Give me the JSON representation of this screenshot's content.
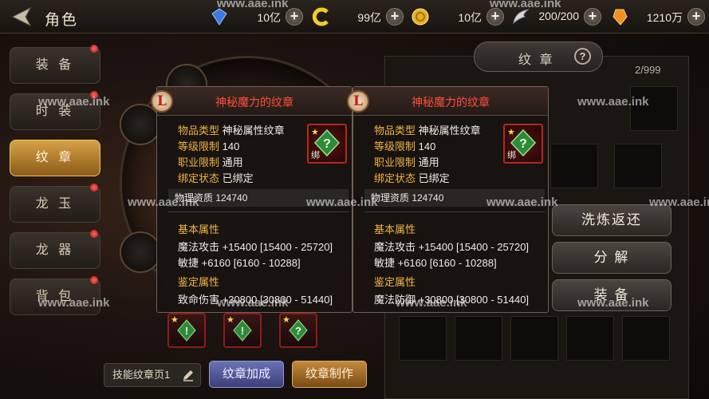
{
  "header": {
    "title": "角色",
    "resources": [
      {
        "icon": "blue-gem-icon",
        "value": "10亿"
      },
      {
        "icon": "yellow-swirl-icon",
        "value": "99亿"
      },
      {
        "icon": "gold-coin-icon",
        "value": "10亿"
      },
      {
        "icon": "silver-wing-icon",
        "value": "200/200"
      },
      {
        "icon": "amber-crystal-icon",
        "value": "1210万"
      }
    ]
  },
  "menu": [
    {
      "label": "装 备",
      "active": false,
      "dot": true
    },
    {
      "label": "时 装",
      "active": false,
      "dot": true
    },
    {
      "label": "纹 章",
      "active": true,
      "dot": false
    },
    {
      "label": "龙 玉",
      "active": false,
      "dot": true
    },
    {
      "label": "龙 器",
      "active": false,
      "dot": true
    },
    {
      "label": "背 包",
      "active": false,
      "dot": true
    }
  ],
  "bottom": {
    "page_select": "技能纹章页1",
    "enhance_button": "纹章加成",
    "craft_button": "纹章制作"
  },
  "right": {
    "title": "纹 章",
    "help": "?",
    "count": "2/999",
    "actions": [
      "洗炼返还",
      "分 解",
      "装 备"
    ]
  },
  "tooltips": [
    {
      "badge": "L",
      "name": "神秘魔力的纹章",
      "fields": [
        {
          "k": "物品类型",
          "v": "神秘属性纹章"
        },
        {
          "k": "等级限制",
          "v": "140"
        },
        {
          "k": "职业限制",
          "v": "通用"
        },
        {
          "k": "绑定状态",
          "v": "已绑定"
        }
      ],
      "icon_label": "绑",
      "aptitude": "物理资质   124740",
      "basic_title": "基本属性",
      "basic": [
        "魔法攻击 +15400 [15400 - 25720]",
        "敏捷 +6160 [6160 - 10288]"
      ],
      "identify_title": "鉴定属性",
      "identify": [
        "致命伤害 +30800 [30800 - 51440]"
      ]
    },
    {
      "badge": "L",
      "name": "神秘魔力的纹章",
      "fields": [
        {
          "k": "物品类型",
          "v": "神秘属性纹章"
        },
        {
          "k": "等级限制",
          "v": "140"
        },
        {
          "k": "职业限制",
          "v": "通用"
        },
        {
          "k": "绑定状态",
          "v": "已绑定"
        }
      ],
      "icon_label": "绑",
      "aptitude": "物理资质   124740",
      "basic_title": "基本属性",
      "basic": [
        "魔法攻击 +15400 [15400 - 25720]",
        "敏捷 +6160 [6160 - 10288]"
      ],
      "identify_title": "鉴定属性",
      "identify": [
        "魔法防御 +30800 [30800 - 51440]"
      ]
    }
  ],
  "watermark": "www.aae.ink",
  "colors": {
    "accent_gold": "#d7a247",
    "quality_red": "#ff4e3a",
    "label_orange": "#f0b640"
  }
}
